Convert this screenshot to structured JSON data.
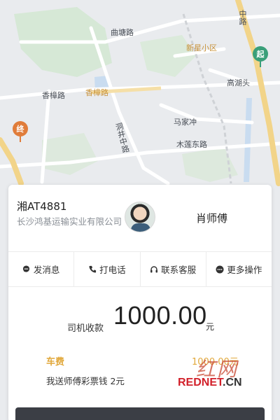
{
  "map": {
    "road_labels": [
      "曲塘路",
      "香樟路",
      "香樟路",
      "洞井中路",
      "木莲东路",
      "马家冲",
      "高湖头",
      "中路"
    ],
    "poi_label": "新星小区",
    "start_pin": "起",
    "end_pin": "终"
  },
  "driver": {
    "plate": "湘AT4881",
    "company": "长沙鸿基运输实业有限公司",
    "name": "肖师傅"
  },
  "actions": [
    {
      "label": "发消息",
      "icon": "message-icon"
    },
    {
      "label": "打电话",
      "icon": "phone-icon"
    },
    {
      "label": "联系客服",
      "icon": "headset-icon"
    },
    {
      "label": "更多操作",
      "icon": "more-icon"
    }
  ],
  "income": {
    "label": "司机收款",
    "amount": "1000.00",
    "unit": "元"
  },
  "fee": {
    "label": "车费",
    "amount": "1000.00元"
  },
  "gift": {
    "text": "我送师傅彩票钱  2元"
  },
  "watermark": {
    "chars": "红网",
    "red": "REDNET",
    "dark": ".CN"
  },
  "colors": {
    "accent": "#e1a83b",
    "start_pin": "#3a9f79",
    "end_pin": "#e07c3a",
    "button": "#3b3e45"
  }
}
